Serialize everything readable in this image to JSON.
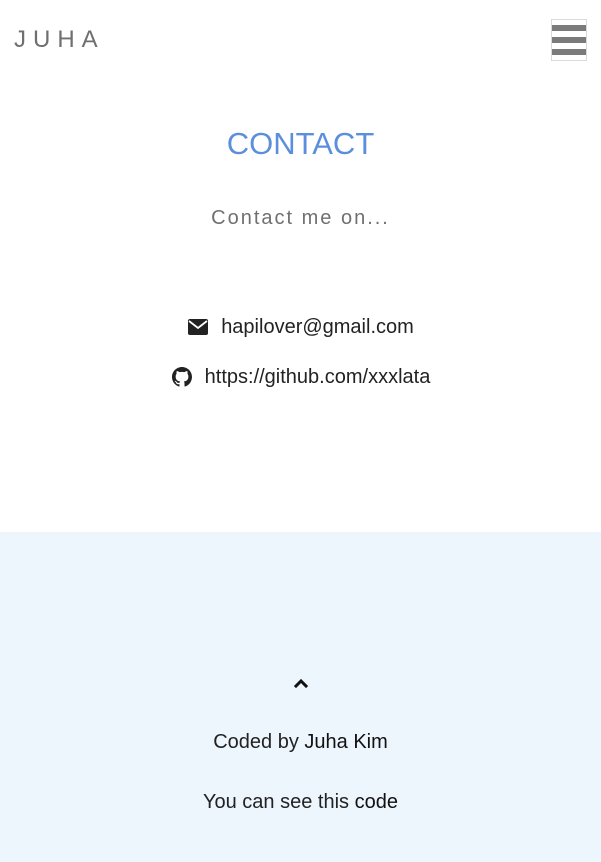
{
  "navbar": {
    "brand": "JUHA",
    "menu_icon": "hamburger-menu-icon"
  },
  "contact": {
    "title": "CONTACT",
    "subtitle": "Contact me on...",
    "email": {
      "icon": "envelope-icon",
      "text": "hapilover@gmail.com"
    },
    "github": {
      "icon": "github-icon",
      "text": "https://github.com/xxxlata"
    }
  },
  "footer": {
    "up_icon": "chevron-up-icon",
    "credit_prefix": "Coded by",
    "credit_name": "Juha Kim",
    "code_prefix": "You can see this",
    "code_link": "code"
  },
  "colors": {
    "accent": "#5b8fdc",
    "footer_bg": "#edf5fd",
    "brand_text": "#6f6f6f"
  }
}
